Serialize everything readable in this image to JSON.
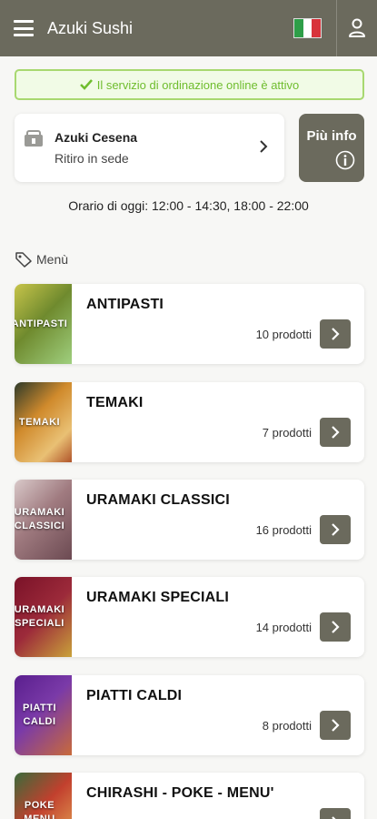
{
  "header": {
    "title": "Azuki Sushi",
    "flag_icon": "italian-flag-icon",
    "user_icon": "user-icon"
  },
  "status": {
    "text": "Il servizio di ordinazione online è attivo",
    "color": "#6fbd2e"
  },
  "store": {
    "name": "Azuki Cesena",
    "mode": "Ritiro in sede"
  },
  "info_button": {
    "label": "Più info"
  },
  "hours": {
    "text": "Orario di oggi: 12:00 - 14:30, 18:00 - 22:00"
  },
  "menu": {
    "heading": "Menù"
  },
  "categories": [
    {
      "title": "ANTIPASTI",
      "count": "10 prodotti",
      "thumb_label": "ANTIPASTI",
      "thumb_color": "#9aa64a"
    },
    {
      "title": "TEMAKI",
      "count": "7 prodotti",
      "thumb_label": "TEMAKI",
      "thumb_color": "#c9812b"
    },
    {
      "title": "URAMAKI CLASSICI",
      "count": "16 prodotti",
      "thumb_label": "URAMAKI\nCLASSICI",
      "thumb_color": "#9a6f75"
    },
    {
      "title": "URAMAKI SPECIALI",
      "count": "14 prodotti",
      "thumb_label": "URAMAKI\nSPECIALI",
      "thumb_color": "#8a1f33"
    },
    {
      "title": "PIATTI CALDI",
      "count": "8 prodotti",
      "thumb_label": "PIATTI\nCALDI",
      "thumb_color": "#5a2a8a"
    },
    {
      "title": "CHIRASHI - POKE - MENU'",
      "count": "",
      "thumb_label": "POKE\nMENU",
      "thumb_color": "#b5382e"
    }
  ],
  "colors": {
    "primary": "#6b6a5d",
    "success_border": "#a8d870",
    "background": "#f7f7f5"
  }
}
